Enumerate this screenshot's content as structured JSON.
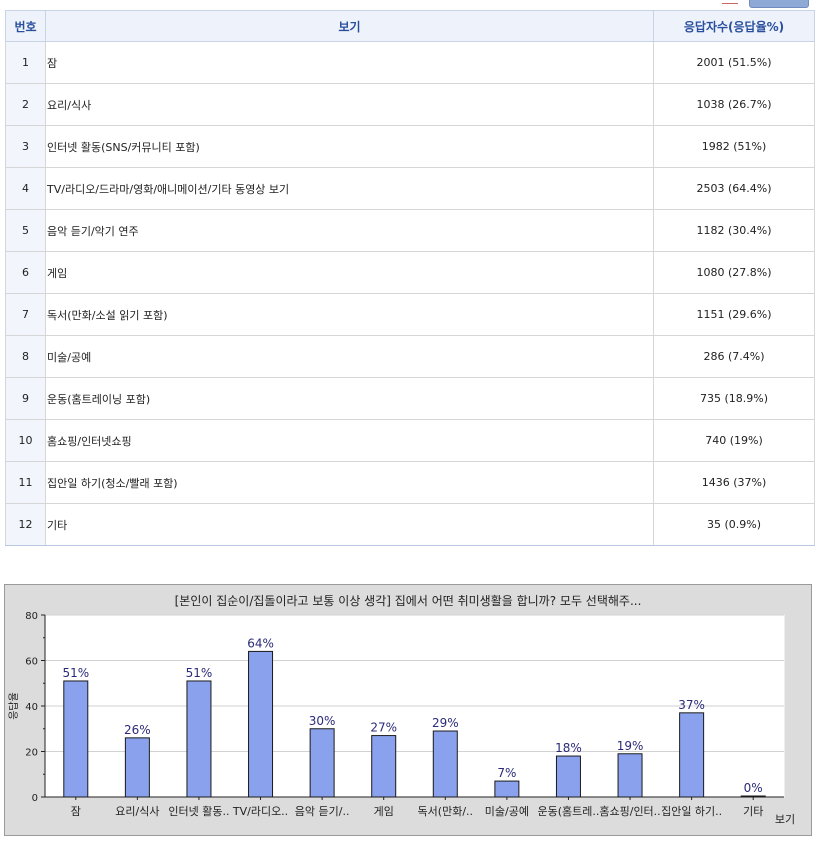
{
  "table": {
    "headers": {
      "num": "번호",
      "option": "보기",
      "responses": "응답자수(응답율%)"
    },
    "rows": [
      {
        "num": "1",
        "label": "잠",
        "value": "2001 (51.5%)"
      },
      {
        "num": "2",
        "label": "요리/식사",
        "value": "1038 (26.7%)"
      },
      {
        "num": "3",
        "label": "인터넷 활동(SNS/커뮤니티 포함)",
        "value": "1982 (51%)"
      },
      {
        "num": "4",
        "label": "TV/라디오/드라마/영화/애니메이션/기타 동영상 보기",
        "value": "2503 (64.4%)"
      },
      {
        "num": "5",
        "label": "음악 듣기/악기 연주",
        "value": "1182 (30.4%)"
      },
      {
        "num": "6",
        "label": "게임",
        "value": "1080 (27.8%)"
      },
      {
        "num": "7",
        "label": "독서(만화/소설 읽기 포함)",
        "value": "1151 (29.6%)"
      },
      {
        "num": "8",
        "label": "미술/공예",
        "value": "286 (7.4%)"
      },
      {
        "num": "9",
        "label": "운동(홈트레이닝 포함)",
        "value": "735 (18.9%)"
      },
      {
        "num": "10",
        "label": "홈쇼핑/인터넷쇼핑",
        "value": "740 (19%)"
      },
      {
        "num": "11",
        "label": "집안일 하기(청소/빨래 포함)",
        "value": "1436 (37%)"
      },
      {
        "num": "12",
        "label": "기타",
        "value": "35 (0.9%)"
      }
    ]
  },
  "colors": {
    "bar": "#8aa2ee",
    "bar_stroke": "#1a1a1a",
    "header_text": "#2a4f9d",
    "label_text": "#2a2a7a"
  },
  "chart_data": {
    "type": "bar",
    "title": "[본인이 집순이/집돌이라고 보통 이상 생각] 집에서 어떤 취미생활을 합니까? 모두 선택해주...",
    "xlabel": "보기",
    "ylabel": "응답율",
    "ylim": [
      0,
      80
    ],
    "yticks": [
      0,
      20,
      40,
      60,
      80
    ],
    "grid": true,
    "categories": [
      "잠",
      "요리/식사",
      "인터넷 활동..",
      "TV/라디오..",
      "음악 듣기/..",
      "게임",
      "독서(만화/..",
      "미술/공예",
      "운동(홈트레..",
      "홈쇼핑/인터..",
      "집안일 하기..",
      "기타"
    ],
    "values": [
      51,
      26,
      51,
      64,
      30,
      27,
      29,
      7,
      18,
      19,
      37,
      0
    ],
    "value_labels": [
      "51%",
      "26%",
      "51%",
      "64%",
      "30%",
      "27%",
      "29%",
      "7%",
      "18%",
      "19%",
      "37%",
      "0%"
    ]
  }
}
